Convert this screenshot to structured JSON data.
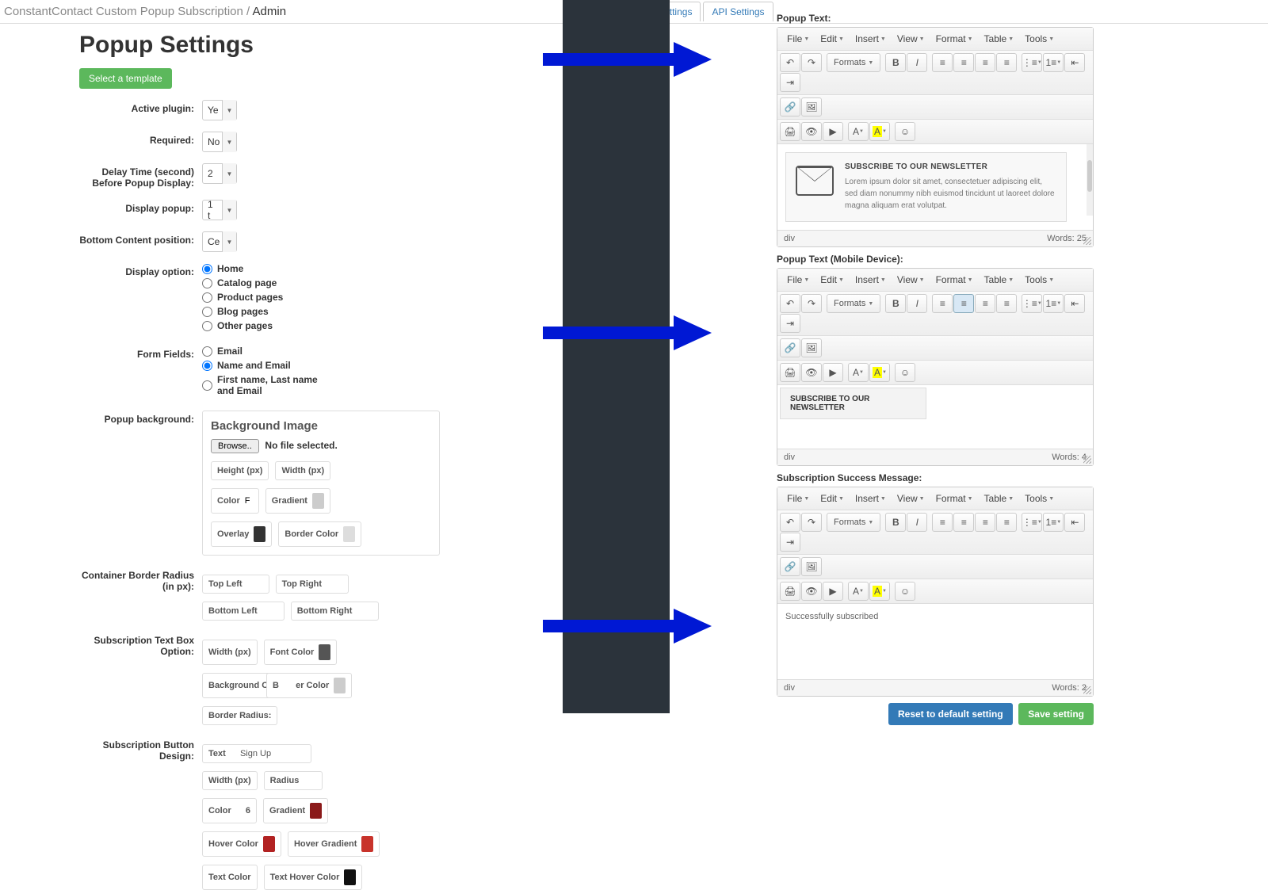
{
  "breadcrumb": {
    "path": "ConstantContact Custom Popup Subscription /",
    "current": "Admin"
  },
  "tabs": [
    "Popup Settings",
    "API Settings"
  ],
  "page_title": "Popup Settings",
  "template_btn": "Select a template",
  "fields": {
    "active_plugin": {
      "label": "Active plugin:",
      "value": "Ye"
    },
    "required": {
      "label": "Required:",
      "value": "No"
    },
    "delay": {
      "label": "Delay Time (second) Before Popup Display:",
      "value": "2"
    },
    "display_popup": {
      "label": "Display popup:",
      "value": "1 t"
    },
    "bottom_pos": {
      "label": "Bottom Content position:",
      "value": "Ce"
    },
    "display_option": {
      "label": "Display option:",
      "options": [
        "Home",
        "Catalog page",
        "Product pages",
        "Blog pages",
        "Other pages"
      ],
      "selected": 0
    },
    "form_fields": {
      "label": "Form Fields:",
      "options": [
        "Email",
        "Name and Email",
        "First name, Last name and Email"
      ],
      "selected": 1
    },
    "popup_bg": {
      "label": "Popup background:",
      "title": "Background Image",
      "browse": "Browse..",
      "no_file": "No file selected.",
      "height": "Height (px)",
      "width": "Width (px)",
      "color": "Color",
      "color_val": "F",
      "gradient": "Gradient",
      "overlay": "Overlay",
      "overlay_color": "#333333",
      "border_color": "Border Color"
    },
    "border_radius": {
      "label": "Container Border Radius (in px):",
      "tl": "Top Left",
      "tr": "Top Right",
      "bl": "Bottom Left",
      "br": "Bottom Right"
    },
    "textbox": {
      "label": "Subscription Text Box Option:",
      "width": "Width (px)",
      "font_color": "Font Color",
      "font_swatch": "#555",
      "bg_color": "Background Col",
      "border_color": "er Color",
      "b_prefix": "B",
      "bc_swatch": "#ccc",
      "border_radius": "Border Radius:"
    },
    "button": {
      "label": "Subscription Button Design:",
      "text": "Text",
      "text_val": "Sign Up",
      "width": "Width (px)",
      "radius": "Radius",
      "color": "Color",
      "color_val": "6",
      "color_swatch": "#8b1a1a",
      "gradient": "Gradient",
      "gradient_swatch": "#8b1a1a",
      "hover_color": "Hover Color",
      "hover_swatch": "#b22222",
      "hover_gradient": "Hover Gradient",
      "hover_g_swatch": "#c8332b",
      "text_color": "Text Color",
      "text_hover_color": "Text Hover Color",
      "thc_swatch": "#111"
    }
  },
  "editors": {
    "menus": [
      "File",
      "Edit",
      "Insert",
      "View",
      "Format",
      "Table",
      "Tools"
    ],
    "formats": "Formats",
    "popup_text": {
      "label": "Popup Text:",
      "headline": "SUBSCRIBE TO OUR NEWSLETTER",
      "body": "Lorem ipsum dolor sit amet, consectetuer adipiscing elit, sed diam nonummy nibh euismod tincidunt ut laoreet dolore magna aliquam erat volutpat.",
      "status_path": "div",
      "words": "Words: 25"
    },
    "popup_text_mobile": {
      "label": "Popup Text (Mobile Device):",
      "headline": "SUBSCRIBE TO OUR NEWSLETTER",
      "status_path": "div",
      "words": "Words: 4"
    },
    "success": {
      "label": "Subscription Success Message:",
      "body": "Successfully subscribed",
      "status_path": "div",
      "words": "Words: 2"
    }
  },
  "buttons": {
    "reset": "Reset to default setting",
    "save": "Save setting"
  }
}
